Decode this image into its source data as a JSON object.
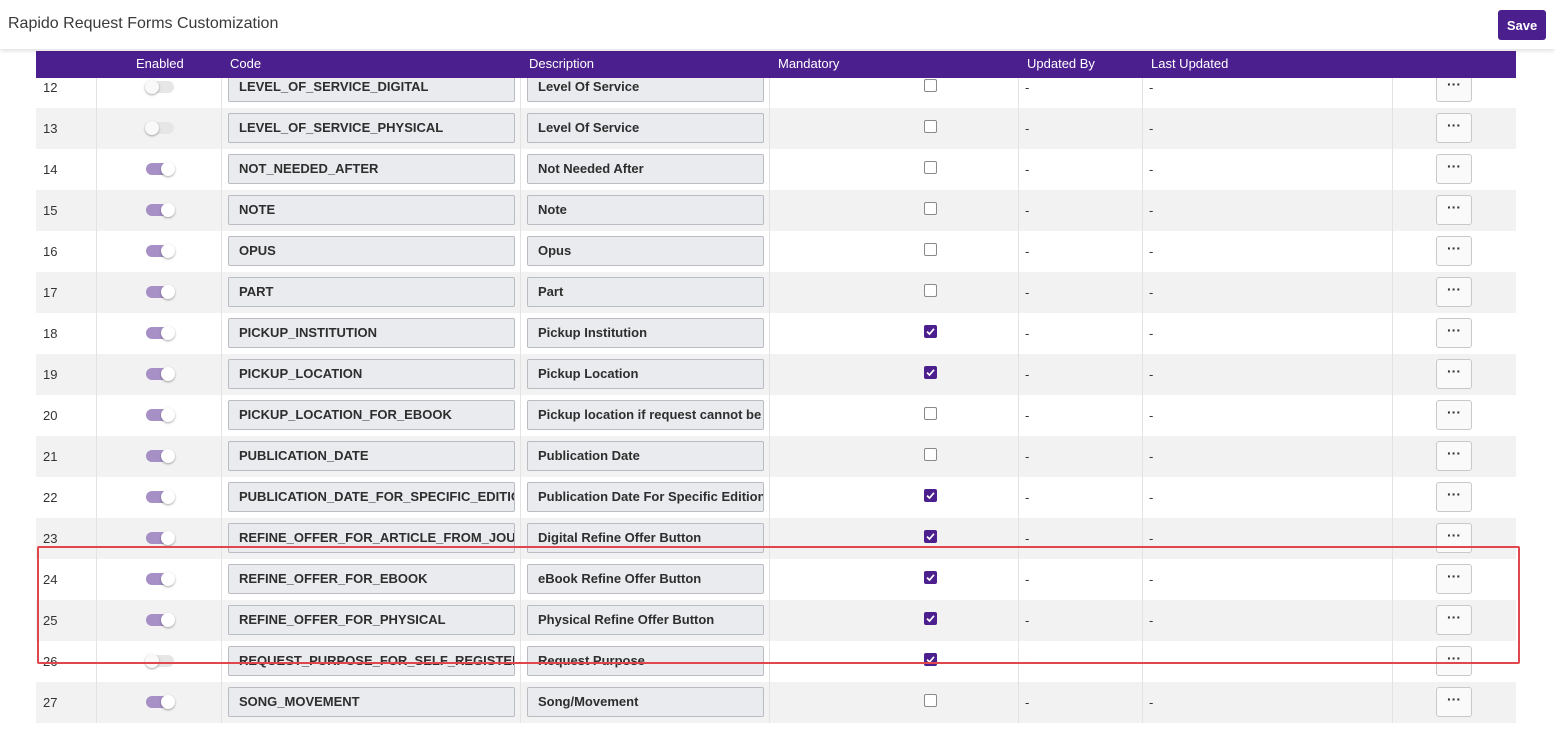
{
  "header": {
    "title": "Rapido Request Forms Customization",
    "save_label": "Save"
  },
  "table": {
    "columns": [
      "Enabled",
      "Code",
      "Description",
      "Mandatory",
      "Updated By",
      "Last Updated"
    ],
    "rows": [
      {
        "num": "12",
        "enabled": false,
        "code": "LEVEL_OF_SERVICE_DIGITAL",
        "description": "Level Of Service",
        "mandatory": false,
        "updated_by": "-",
        "last_updated": "-"
      },
      {
        "num": "13",
        "enabled": false,
        "code": "LEVEL_OF_SERVICE_PHYSICAL",
        "description": "Level Of Service",
        "mandatory": false,
        "updated_by": "-",
        "last_updated": "-"
      },
      {
        "num": "14",
        "enabled": true,
        "code": "NOT_NEEDED_AFTER",
        "description": "Not Needed After",
        "mandatory": false,
        "updated_by": "-",
        "last_updated": "-"
      },
      {
        "num": "15",
        "enabled": true,
        "code": "NOTE",
        "description": "Note",
        "mandatory": false,
        "updated_by": "-",
        "last_updated": "-"
      },
      {
        "num": "16",
        "enabled": true,
        "code": "OPUS",
        "description": "Opus",
        "mandatory": false,
        "updated_by": "-",
        "last_updated": "-"
      },
      {
        "num": "17",
        "enabled": true,
        "code": "PART",
        "description": "Part",
        "mandatory": false,
        "updated_by": "-",
        "last_updated": "-"
      },
      {
        "num": "18",
        "enabled": true,
        "code": "PICKUP_INSTITUTION",
        "description": "Pickup Institution",
        "mandatory": true,
        "updated_by": "-",
        "last_updated": "-"
      },
      {
        "num": "19",
        "enabled": true,
        "code": "PICKUP_LOCATION",
        "description": "Pickup Location",
        "mandatory": true,
        "updated_by": "-",
        "last_updated": "-"
      },
      {
        "num": "20",
        "enabled": true,
        "code": "PICKUP_LOCATION_FOR_EBOOK",
        "description": "Pickup location if request cannot be su",
        "mandatory": false,
        "updated_by": "-",
        "last_updated": "-"
      },
      {
        "num": "21",
        "enabled": true,
        "code": "PUBLICATION_DATE",
        "description": "Publication Date",
        "mandatory": false,
        "updated_by": "-",
        "last_updated": "-"
      },
      {
        "num": "22",
        "enabled": true,
        "code": "PUBLICATION_DATE_FOR_SPECIFIC_EDITION",
        "description": "Publication Date For Specific Edition",
        "mandatory": true,
        "updated_by": "-",
        "last_updated": "-"
      },
      {
        "num": "23",
        "enabled": true,
        "code": "REFINE_OFFER_FOR_ARTICLE_FROM_JOURNA",
        "description": "Digital Refine Offer Button",
        "mandatory": true,
        "updated_by": "-",
        "last_updated": "-"
      },
      {
        "num": "24",
        "enabled": true,
        "code": "REFINE_OFFER_FOR_EBOOK",
        "description": "eBook Refine Offer Button",
        "mandatory": true,
        "updated_by": "-",
        "last_updated": "-"
      },
      {
        "num": "25",
        "enabled": true,
        "code": "REFINE_OFFER_FOR_PHYSICAL",
        "description": "Physical Refine Offer Button",
        "mandatory": true,
        "updated_by": "-",
        "last_updated": "-"
      },
      {
        "num": "26",
        "enabled": false,
        "code": "REQUEST_PURPOSE_FOR_SELF_REGISTERED_I",
        "description": "Request Purpose",
        "mandatory": true,
        "updated_by": "-",
        "last_updated": "-"
      },
      {
        "num": "27",
        "enabled": true,
        "code": "SONG_MOVEMENT",
        "description": "Song/Movement",
        "mandatory": false,
        "updated_by": "-",
        "last_updated": "-"
      }
    ],
    "action_label": "···"
  },
  "colors": {
    "accent": "#4c1f8e",
    "toggle_on": "#a690c6",
    "highlight": "#e0474c"
  }
}
